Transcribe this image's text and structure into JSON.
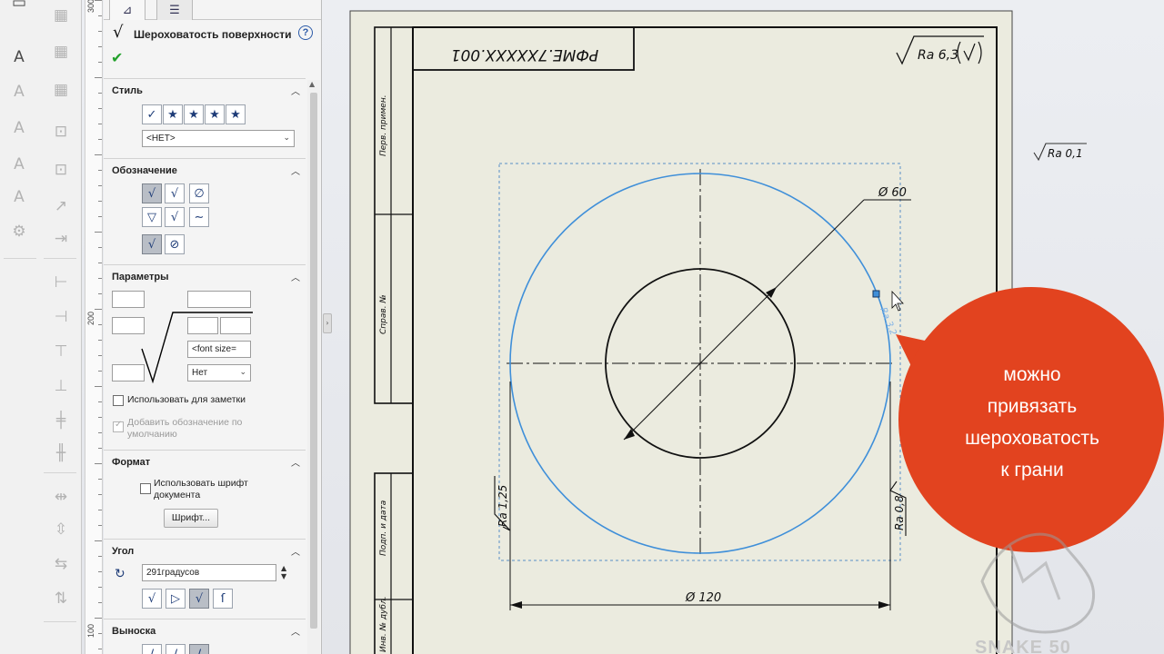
{
  "panel": {
    "title": "Шероховатость поверхности",
    "help": "?",
    "style_group": {
      "title": "Стиль",
      "select_value": "<НЕТ>"
    },
    "symbol_group": {
      "title": "Обозначение"
    },
    "params_group": {
      "title": "Параметры",
      "font_size_placeholder": "<font size=",
      "lay_select_value": "Нет",
      "use_for_notes": "Использовать для заметки",
      "add_default": "Добавить обозначение по умолчанию"
    },
    "format_group": {
      "title": "Формат",
      "use_doc_font": "Использовать шрифт документа",
      "font_button": "Шрифт..."
    },
    "angle_group": {
      "title": "Угол",
      "angle_value": "291градусов"
    },
    "leader_group": {
      "title": "Выноска"
    }
  },
  "ruler": {
    "labels": [
      "300",
      "200",
      "100"
    ]
  },
  "drawing": {
    "title_block_text": "РФМЕ.7XXXXX.001",
    "general_roughness": "Ra 6,3",
    "outside_roughness": "Ra 0,1",
    "diameter_small": "Ø 60",
    "diameter_large": "Ø 120",
    "roughness_left": "Ra 1,25",
    "roughness_right": "Ra 0,8",
    "roughness_ghost": "Ra 3,2",
    "side_labels": [
      "Перв. примен.",
      "Справ. №",
      "Подп. и дата",
      "Инв. № дубл."
    ]
  },
  "callout": {
    "lines": [
      "можно",
      "привязать",
      "шероховатость",
      "к грани"
    ],
    "color": "#e2431f"
  },
  "watermark": "SNAKE 50",
  "colors": {
    "selection_blue": "#3f8fd9",
    "check_green": "#23a12c"
  }
}
